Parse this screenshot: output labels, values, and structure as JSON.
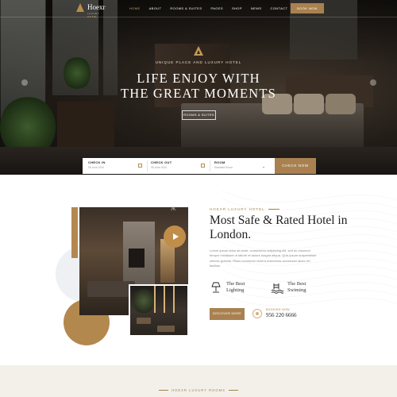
{
  "brand": {
    "name": "Hoexr",
    "tagline": "LUXURY HOTEL"
  },
  "nav": {
    "items": [
      "HOME",
      "ABOUT",
      "ROOMS & SUITES",
      "PAGES",
      "SHOP",
      "NEWS",
      "CONTACT"
    ],
    "active_index": 0,
    "cta": "BOOK NOW"
  },
  "hero": {
    "subtitle": "UNIQUE PLACE AND LUXURY HOTEL",
    "title_line1": "LIFE ENJOY WITH",
    "title_line2": "THE GREAT MOMENTS",
    "button": "ROOMS & SUITES"
  },
  "booking": {
    "checkin_label": "CHECK IN",
    "checkin_value": "05 June 2024",
    "checkout_label": "CHECK OUT",
    "checkout_value": "05 June 2024",
    "room_label": "ROOM",
    "room_value": "Standard Room",
    "button": "CHECK NOW"
  },
  "about": {
    "eyebrow": "HOEXR LUXURY HOTEL",
    "title": "Most Safe & Rated Hotel in London.",
    "text": "Lorem ipsum dolor sit amet, consectetur adipiscing elit, sed do eiusmod tempor incididunt ut labore et dolore magna aliqua. Quis ipsum suspendisse ultrices gravida. Risus commodo viverra maecenas accumsan lacus vel facilisis.",
    "features": [
      {
        "icon": "lamp-icon",
        "label": "The Best Lighting"
      },
      {
        "icon": "pool-icon",
        "label": "The Best Swiming"
      }
    ],
    "button": "DISCOVER MORE",
    "call_label": "BOOKING NOW",
    "call_number": "956 220 6666"
  },
  "next_section": {
    "eyebrow": "HOEXR LUXURY ROOMS"
  },
  "colors": {
    "accent": "#a98150",
    "dark": "#1f1f1f"
  }
}
